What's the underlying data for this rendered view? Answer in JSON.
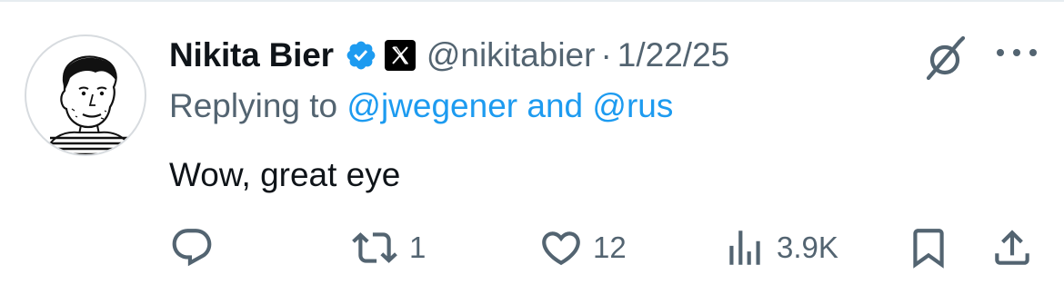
{
  "tweet": {
    "author": {
      "display_name": "Nikita Bier",
      "handle": "@nikitabier",
      "verified": true,
      "affiliate_badge": "x-logo-icon"
    },
    "separator": "·",
    "date": "1/22/25",
    "reply_prefix": "Replying to",
    "reply_mentions": "@jwegener and @rus",
    "text": "Wow, great eye",
    "actions": {
      "replies": "",
      "retweets": "1",
      "likes": "12",
      "views": "3.9K"
    }
  },
  "colors": {
    "text": "#0f1419",
    "secondary": "#536471",
    "accent": "#1d9bf0",
    "divider": "#e6ecf0"
  },
  "icons": [
    "verified-badge-icon",
    "x-logo-icon",
    "grok-icon",
    "more-icon",
    "reply-icon",
    "retweet-icon",
    "like-icon",
    "views-icon",
    "bookmark-icon",
    "share-icon"
  ]
}
